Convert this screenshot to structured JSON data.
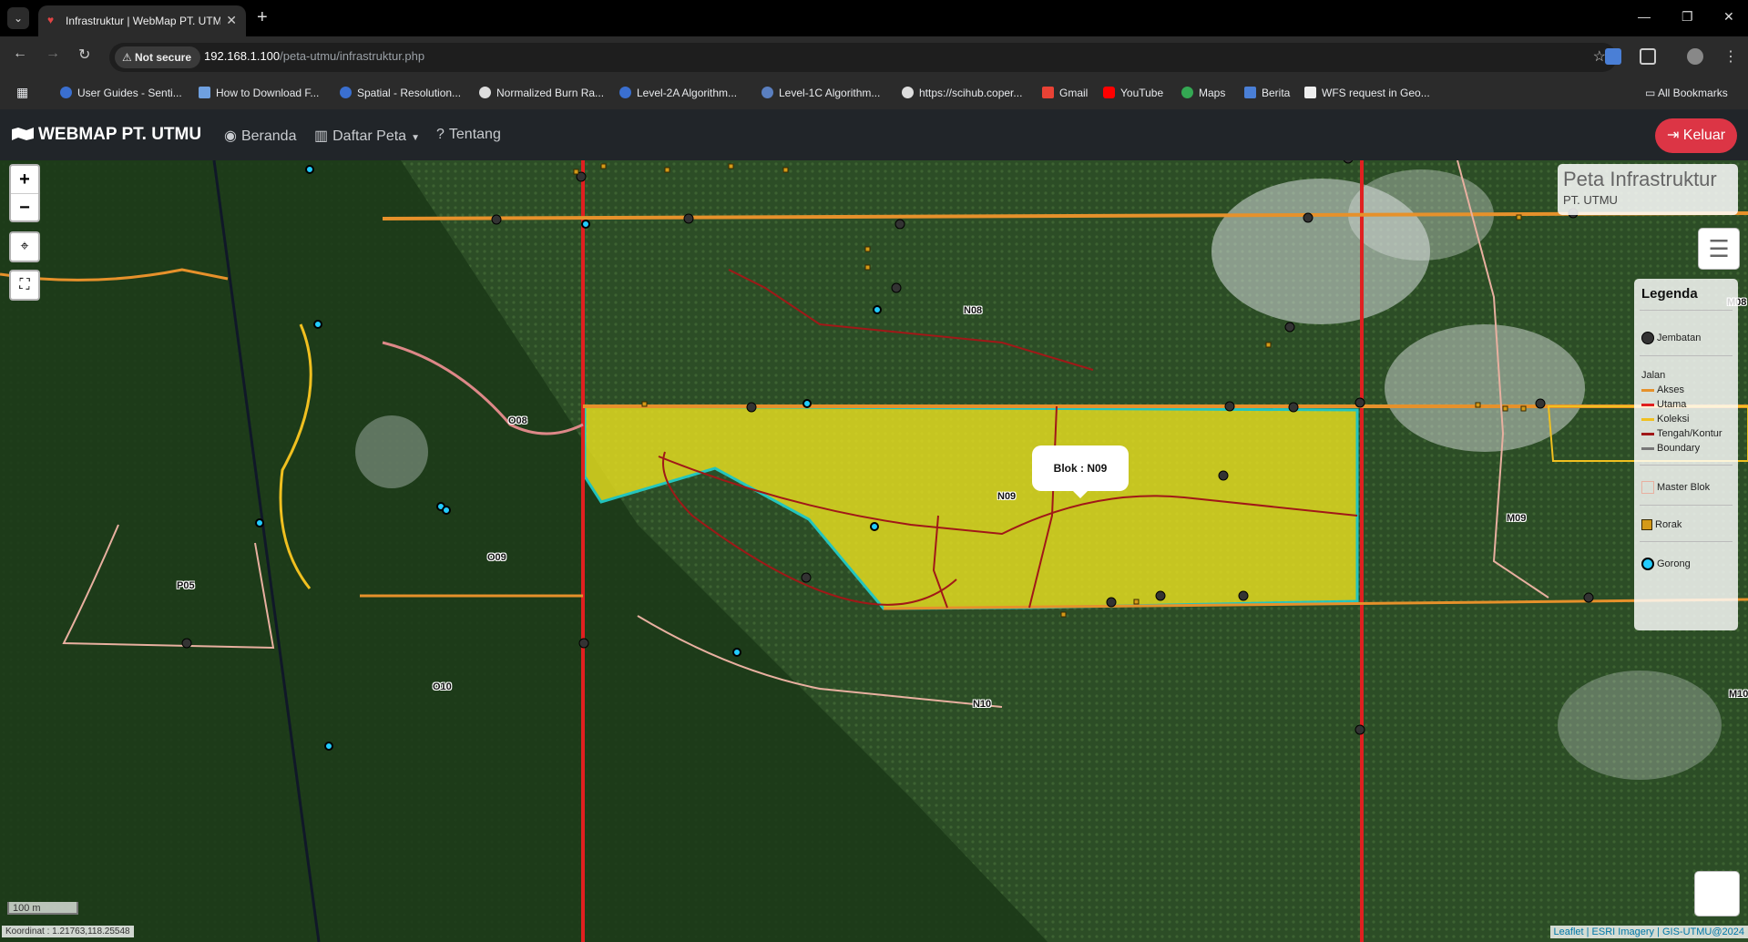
{
  "browser": {
    "tab_title": "Infrastruktur | WebMap PT. UTM",
    "not_secure": "Not secure",
    "url_host": "192.168.1.100",
    "url_path": "/peta-utmu/infrastruktur.php",
    "bookmarks": [
      "User Guides - Senti...",
      "How to Download F...",
      "Spatial - Resolution...",
      "Normalized Burn Ra...",
      "Level-2A Algorithm...",
      "Level-1C Algorithm...",
      "https://scihub.coper...",
      "Gmail",
      "YouTube",
      "Maps",
      "Berita",
      "WFS request in Geo..."
    ],
    "all_bookmarks": "All Bookmarks"
  },
  "app": {
    "brand": "WEBMAP PT. UTMU",
    "nav": {
      "beranda": "Beranda",
      "daftar_peta": "Daftar Peta",
      "tentang": "Tentang"
    },
    "logout": "Keluar"
  },
  "map": {
    "title": "Peta Infrastruktur",
    "subtitle": "PT. UTMU",
    "popup": "Blok : N09",
    "block_labels": [
      "N08",
      "O08",
      "N09",
      "O09",
      "P05",
      "O10",
      "N10",
      "M09",
      "M08",
      "M10"
    ],
    "scale": "100 m",
    "coordinates": "Koordinat : 1.21763,118.25548",
    "attribution": "Leaflet | ESRI Imagery | GIS-UTMU@2024"
  },
  "legend": {
    "title": "Legenda",
    "jembatan": "Jembatan",
    "jalan_title": "Jalan",
    "jalan": [
      {
        "label": "Akses",
        "color": "#e6912b"
      },
      {
        "label": "Utama",
        "color": "#e02020"
      },
      {
        "label": "Koleksi",
        "color": "#f0c020"
      },
      {
        "label": "Tengah/Kontur",
        "color": "#a01818"
      },
      {
        "label": "Boundary",
        "color": "#777777"
      }
    ],
    "master_blok": "Master Blok",
    "rorak": "Rorak",
    "gorong": "Gorong"
  },
  "colors": {
    "selected_block": "#e8e020",
    "selected_outline": "#22e0e0",
    "logout": "#dc3545"
  }
}
